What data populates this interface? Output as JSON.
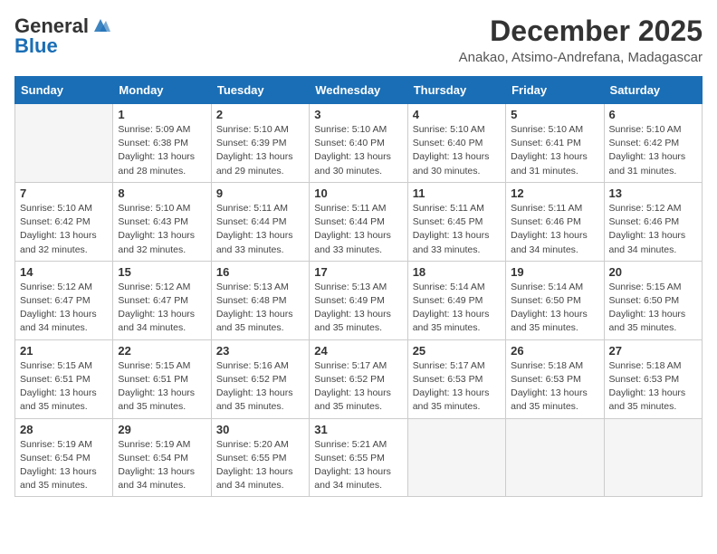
{
  "header": {
    "logo_line1": "General",
    "logo_line2": "Blue",
    "month": "December 2025",
    "location": "Anakao, Atsimo-Andrefana, Madagascar"
  },
  "weekdays": [
    "Sunday",
    "Monday",
    "Tuesday",
    "Wednesday",
    "Thursday",
    "Friday",
    "Saturday"
  ],
  "weeks": [
    [
      {
        "day": "",
        "info": ""
      },
      {
        "day": "1",
        "info": "Sunrise: 5:09 AM\nSunset: 6:38 PM\nDaylight: 13 hours\nand 28 minutes."
      },
      {
        "day": "2",
        "info": "Sunrise: 5:10 AM\nSunset: 6:39 PM\nDaylight: 13 hours\nand 29 minutes."
      },
      {
        "day": "3",
        "info": "Sunrise: 5:10 AM\nSunset: 6:40 PM\nDaylight: 13 hours\nand 30 minutes."
      },
      {
        "day": "4",
        "info": "Sunrise: 5:10 AM\nSunset: 6:40 PM\nDaylight: 13 hours\nand 30 minutes."
      },
      {
        "day": "5",
        "info": "Sunrise: 5:10 AM\nSunset: 6:41 PM\nDaylight: 13 hours\nand 31 minutes."
      },
      {
        "day": "6",
        "info": "Sunrise: 5:10 AM\nSunset: 6:42 PM\nDaylight: 13 hours\nand 31 minutes."
      }
    ],
    [
      {
        "day": "7",
        "info": "Sunrise: 5:10 AM\nSunset: 6:42 PM\nDaylight: 13 hours\nand 32 minutes."
      },
      {
        "day": "8",
        "info": "Sunrise: 5:10 AM\nSunset: 6:43 PM\nDaylight: 13 hours\nand 32 minutes."
      },
      {
        "day": "9",
        "info": "Sunrise: 5:11 AM\nSunset: 6:44 PM\nDaylight: 13 hours\nand 33 minutes."
      },
      {
        "day": "10",
        "info": "Sunrise: 5:11 AM\nSunset: 6:44 PM\nDaylight: 13 hours\nand 33 minutes."
      },
      {
        "day": "11",
        "info": "Sunrise: 5:11 AM\nSunset: 6:45 PM\nDaylight: 13 hours\nand 33 minutes."
      },
      {
        "day": "12",
        "info": "Sunrise: 5:11 AM\nSunset: 6:46 PM\nDaylight: 13 hours\nand 34 minutes."
      },
      {
        "day": "13",
        "info": "Sunrise: 5:12 AM\nSunset: 6:46 PM\nDaylight: 13 hours\nand 34 minutes."
      }
    ],
    [
      {
        "day": "14",
        "info": "Sunrise: 5:12 AM\nSunset: 6:47 PM\nDaylight: 13 hours\nand 34 minutes."
      },
      {
        "day": "15",
        "info": "Sunrise: 5:12 AM\nSunset: 6:47 PM\nDaylight: 13 hours\nand 34 minutes."
      },
      {
        "day": "16",
        "info": "Sunrise: 5:13 AM\nSunset: 6:48 PM\nDaylight: 13 hours\nand 35 minutes."
      },
      {
        "day": "17",
        "info": "Sunrise: 5:13 AM\nSunset: 6:49 PM\nDaylight: 13 hours\nand 35 minutes."
      },
      {
        "day": "18",
        "info": "Sunrise: 5:14 AM\nSunset: 6:49 PM\nDaylight: 13 hours\nand 35 minutes."
      },
      {
        "day": "19",
        "info": "Sunrise: 5:14 AM\nSunset: 6:50 PM\nDaylight: 13 hours\nand 35 minutes."
      },
      {
        "day": "20",
        "info": "Sunrise: 5:15 AM\nSunset: 6:50 PM\nDaylight: 13 hours\nand 35 minutes."
      }
    ],
    [
      {
        "day": "21",
        "info": "Sunrise: 5:15 AM\nSunset: 6:51 PM\nDaylight: 13 hours\nand 35 minutes."
      },
      {
        "day": "22",
        "info": "Sunrise: 5:15 AM\nSunset: 6:51 PM\nDaylight: 13 hours\nand 35 minutes."
      },
      {
        "day": "23",
        "info": "Sunrise: 5:16 AM\nSunset: 6:52 PM\nDaylight: 13 hours\nand 35 minutes."
      },
      {
        "day": "24",
        "info": "Sunrise: 5:17 AM\nSunset: 6:52 PM\nDaylight: 13 hours\nand 35 minutes."
      },
      {
        "day": "25",
        "info": "Sunrise: 5:17 AM\nSunset: 6:53 PM\nDaylight: 13 hours\nand 35 minutes."
      },
      {
        "day": "26",
        "info": "Sunrise: 5:18 AM\nSunset: 6:53 PM\nDaylight: 13 hours\nand 35 minutes."
      },
      {
        "day": "27",
        "info": "Sunrise: 5:18 AM\nSunset: 6:53 PM\nDaylight: 13 hours\nand 35 minutes."
      }
    ],
    [
      {
        "day": "28",
        "info": "Sunrise: 5:19 AM\nSunset: 6:54 PM\nDaylight: 13 hours\nand 35 minutes."
      },
      {
        "day": "29",
        "info": "Sunrise: 5:19 AM\nSunset: 6:54 PM\nDaylight: 13 hours\nand 34 minutes."
      },
      {
        "day": "30",
        "info": "Sunrise: 5:20 AM\nSunset: 6:55 PM\nDaylight: 13 hours\nand 34 minutes."
      },
      {
        "day": "31",
        "info": "Sunrise: 5:21 AM\nSunset: 6:55 PM\nDaylight: 13 hours\nand 34 minutes."
      },
      {
        "day": "",
        "info": ""
      },
      {
        "day": "",
        "info": ""
      },
      {
        "day": "",
        "info": ""
      }
    ]
  ]
}
